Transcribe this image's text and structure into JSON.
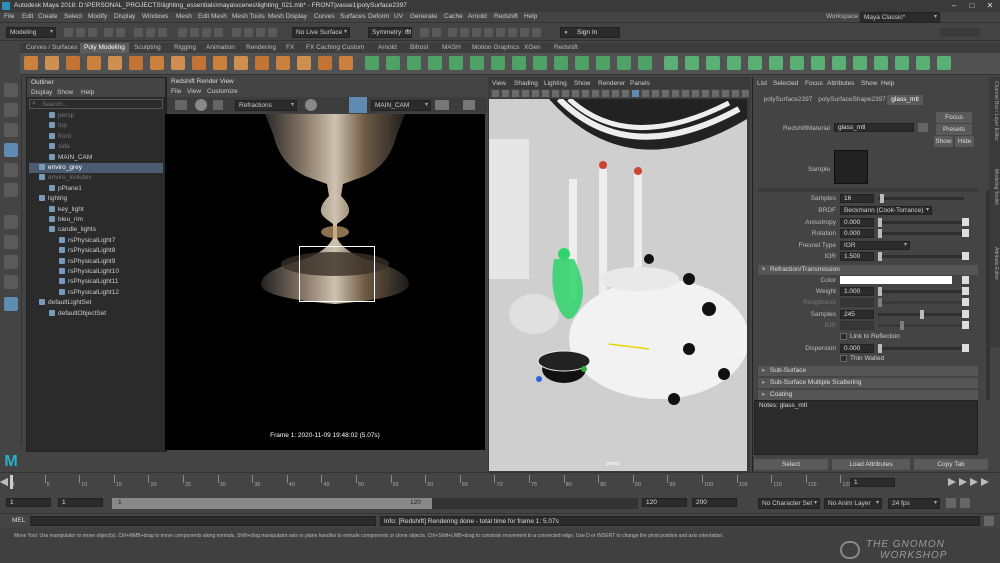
{
  "window": {
    "title": "Autodesk Maya 2018: D:\\PERSONAL_PROJECTS\\lighting_essentials\\maya\\scenes\\lighting_021.mb*  -  FRONT|vasse1|polySurface2397",
    "workspace_label": "Workspace :",
    "workspace_value": "Maya Classic*"
  },
  "menus": [
    "File",
    "Edit",
    "Create",
    "Select",
    "Modify",
    "Display",
    "Windows",
    "Mesh",
    "Edit Mesh",
    "Mesh Tools",
    "Mesh Display",
    "Curves",
    "Surfaces",
    "Deform",
    "UV",
    "Generate",
    "Cache",
    "Arnold",
    "Redshift",
    "Help"
  ],
  "status": {
    "mode": "Modeling",
    "live": "No Live Surface",
    "symmetry": "Symmetry: Off",
    "signin": "Sign In"
  },
  "shelf_tabs": [
    "Curves / Surfaces",
    "Poly Modeling",
    "Sculpting",
    "Rigging",
    "Animation",
    "Rendering",
    "FX",
    "FX Caching",
    "Custom",
    "Arnold",
    "Bifrost",
    "MASH",
    "Motion Graphics",
    "XGen",
    "Redshift"
  ],
  "outliner": {
    "title": "Outliner",
    "menu": [
      "Display",
      "Show",
      "Help"
    ],
    "search_placeholder": "Search...",
    "items": [
      {
        "label": "persp",
        "dim": true
      },
      {
        "label": "top",
        "dim": true
      },
      {
        "label": "front",
        "dim": true
      },
      {
        "label": "side",
        "dim": true
      },
      {
        "label": "MAIN_CAM",
        "dim": false
      },
      {
        "label": "enviro_grey",
        "dim": false,
        "hl": true
      },
      {
        "label": "enviro_lookdev",
        "dim": true
      },
      {
        "label": "pPlane1",
        "dim": false
      },
      {
        "label": "lightrig",
        "dim": false
      },
      {
        "label": "key_light",
        "dim": false
      },
      {
        "label": "bleu_rim",
        "dim": false
      },
      {
        "label": "candle_lights",
        "dim": false
      },
      {
        "label": "rsPhysicalLight7",
        "dim": false
      },
      {
        "label": "rsPhysicalLight8",
        "dim": false
      },
      {
        "label": "rsPhysicalLight9",
        "dim": false
      },
      {
        "label": "rsPhysicalLight10",
        "dim": false
      },
      {
        "label": "rsPhysicalLight11",
        "dim": false
      },
      {
        "label": "rsPhysicalLight12",
        "dim": false
      },
      {
        "label": "defaultLightSet",
        "dim": false
      },
      {
        "label": "defaultObjectSet",
        "dim": false
      }
    ]
  },
  "render_view": {
    "title": "Redshift Render View",
    "menu": [
      "File",
      "View",
      "Customize"
    ],
    "aov": "Refractions",
    "camera": "MAIN_CAM",
    "frame_text": "Frame 1:  2020-11-09  19:48:02  (5.07s)"
  },
  "viewport": {
    "menu": [
      "View",
      "Shading",
      "Lighting",
      "Show",
      "Renderer",
      "Panels"
    ],
    "persp_label": "persp"
  },
  "attr_editor": {
    "menu": [
      "List",
      "Selected",
      "Focus",
      "Attributes",
      "Show",
      "Help"
    ],
    "tabs": [
      "polySurface2397",
      "polySurfaceShape2397",
      "glass_mtl"
    ],
    "material_label": "RedshiftMaterial",
    "material_value": "glass_mtl",
    "focus": "Focus",
    "presets": "Presets",
    "show": "Show",
    "hide": "Hide",
    "sample_label": "Sample",
    "refl": [
      {
        "label": "Samples",
        "value": "16"
      },
      {
        "label": "BRDF",
        "value": "Beckmann (Cook-Torrance)"
      },
      {
        "label": "Anisotropy",
        "value": "0.000"
      },
      {
        "label": "Rotation",
        "value": "0.000"
      },
      {
        "label": "Fresnel Type",
        "value": "IOR"
      },
      {
        "label": "IOR",
        "value": "1.500"
      }
    ],
    "refraction_title": "Refraction/Transmission",
    "refr": [
      {
        "label": "Color",
        "value": ""
      },
      {
        "label": "Weight",
        "value": "1.000"
      },
      {
        "label": "Roughness",
        "value": ""
      },
      {
        "label": "Samples",
        "value": "245"
      },
      {
        "label": "IOR",
        "value": ""
      },
      {
        "label": "",
        "value": "Link to Reflection"
      },
      {
        "label": "Dispersion",
        "value": "0.000"
      },
      {
        "label": "",
        "value": "Thin Walled"
      }
    ],
    "sections": [
      "Sub-Surface",
      "Sub-Surface Multiple Scattering",
      "Coating"
    ],
    "notes": "Notes:  glass_mtl",
    "buttons": [
      "Select",
      "Load Attributes",
      "Copy Tab"
    ]
  },
  "side_tabs": [
    "Channel Box / Layer Editor",
    "Modeling Toolkit",
    "Attribute Editor"
  ],
  "timeline": {
    "ticks": [
      "1",
      "5",
      "10",
      "15",
      "20",
      "25",
      "30",
      "35",
      "40",
      "45",
      "50",
      "55",
      "60",
      "65",
      "70",
      "75",
      "80",
      "85",
      "90",
      "95",
      "100",
      "105",
      "110",
      "115",
      "120"
    ],
    "current": "1"
  },
  "range": {
    "start": "1",
    "start2": "1",
    "slider_mid": "1",
    "slider_end": "120",
    "end": "120",
    "end2": "200",
    "character_set": "No Character Set",
    "anim_layer": "No Anim Layer",
    "fps": "24 fps"
  },
  "cmd": {
    "lang": "MEL",
    "result": "Info: [Redshift] Rendering done - total time for frame 1: 5.07s"
  },
  "help_line": "Move Tool: Use manipulator to move object(s). Ctrl+MMB+drag to move components along normals. Shift+drag manipulator axis or plane handles to extrude components or clone objects. Ctrl+Shift+LMB+drag to constrain movement to a connected edge. Use D or INSERT to change the pivot position and axis orientation.",
  "watermark": {
    "line1": "THE GNOMON",
    "line2": "WORKSHOP"
  },
  "colors": {
    "accent": "#5f8bb3",
    "selection": "#4b5b70",
    "shelf_orange": "#e0883a",
    "shelf_green": "#4fb06a"
  }
}
